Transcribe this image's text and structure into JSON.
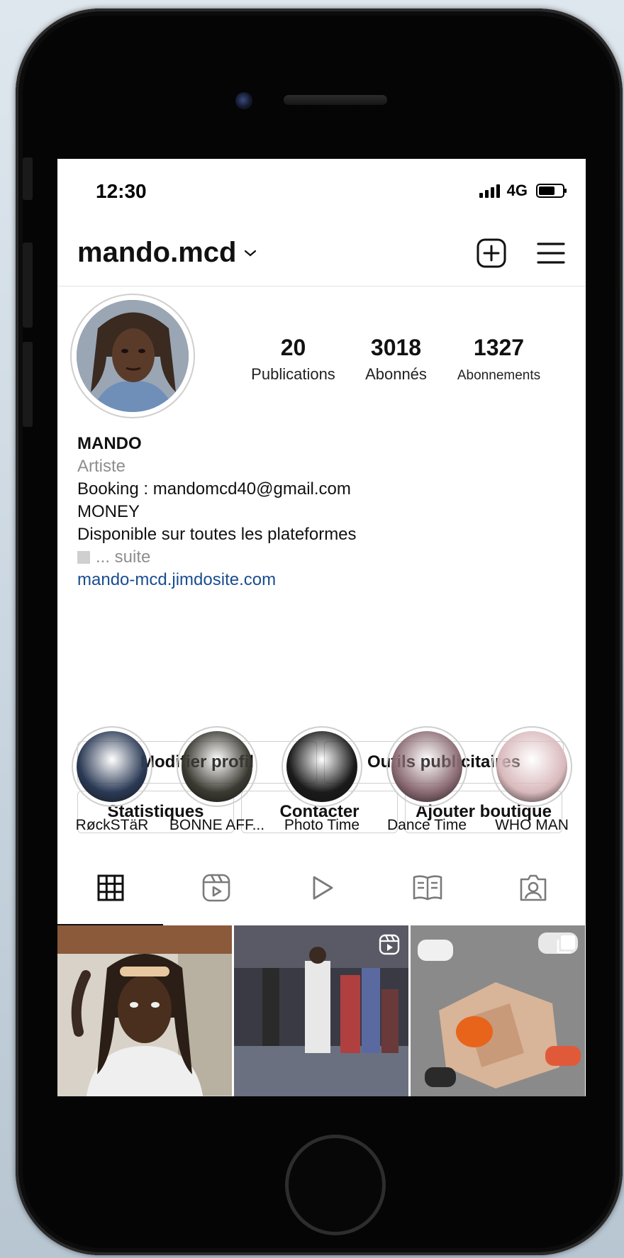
{
  "status_bar": {
    "time": "12:30",
    "network": "4G"
  },
  "header": {
    "username": "mando.mcd"
  },
  "stats": [
    {
      "value": "20",
      "label": "Publications"
    },
    {
      "value": "3018",
      "label": "Abonnés"
    },
    {
      "value": "1327",
      "label": "Abonnements"
    }
  ],
  "bio": {
    "name": "MANDO",
    "category": "Artiste",
    "lines": [
      "Booking : mandomcd40@gmail.com",
      "MONEY",
      "Disponible sur toutes les plateformes"
    ],
    "more": "... suite",
    "link": "mando-mcd.jimdosite.com"
  },
  "buttons": {
    "edit_profile": "Modifier profil",
    "ad_tools": "Outils publicitaires",
    "insights": "Statistiques",
    "contact": "Contacter",
    "add_shop": "Ajouter boutique"
  },
  "highlights": [
    {
      "label": "RøckSTäR",
      "color": "#2b3a55"
    },
    {
      "label": "BONNE AFF...",
      "color": "#3b3a32"
    },
    {
      "label": "Photo Time",
      "color": "#1a1a1a"
    },
    {
      "label": "Dance Time",
      "color": "#8a6a72"
    },
    {
      "label": "WHO MAN",
      "color": "#d9b9bc"
    }
  ],
  "tabs": [
    "grid",
    "reels",
    "videos",
    "guides",
    "tagged"
  ],
  "posts": [
    {
      "type": "photo",
      "color": "#5a4a3a"
    },
    {
      "type": "reel",
      "color": "#4a5060"
    },
    {
      "type": "carousel",
      "color": "#c8a48a"
    }
  ]
}
